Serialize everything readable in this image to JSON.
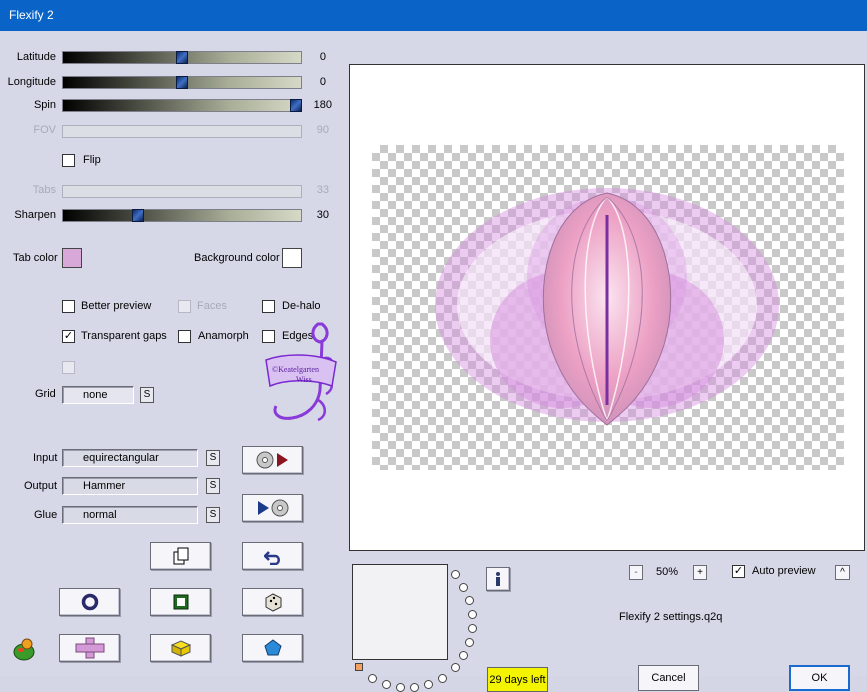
{
  "window": {
    "title": "Flexify 2"
  },
  "sliders": {
    "latitude": {
      "label": "Latitude",
      "value": "0",
      "level": 0.5
    },
    "longitude": {
      "label": "Longitude",
      "value": "0",
      "level": 0.5
    },
    "spin": {
      "label": "Spin",
      "value": "180",
      "level": 1.0
    },
    "fov": {
      "label": "FOV",
      "value": "90",
      "level": 0.5
    },
    "tabs": {
      "label": "Tabs",
      "value": "33",
      "level": 0.33
    },
    "sharpen": {
      "label": "Sharpen",
      "value": "30",
      "level": 0.3
    }
  },
  "flip": {
    "label": "Flip",
    "checked": false
  },
  "colors": {
    "tab_color_label": "Tab color",
    "tab_color": "#d8a8d8",
    "background_color_label": "Background color",
    "background_color": "#ffffff"
  },
  "options": {
    "better_preview": "Better preview",
    "faces": "Faces",
    "de_halo": "De-halo",
    "transparent_gaps": "Transparent gaps",
    "anamorph": "Anamorph",
    "edges": "Edges"
  },
  "grid": {
    "label": "Grid",
    "value": "none",
    "button": "S"
  },
  "io": {
    "input_label": "Input",
    "input_value": "equirectangular",
    "output_label": "Output",
    "output_value": "Hammer",
    "glue_label": "Glue",
    "glue_value": "normal",
    "s_button": "S"
  },
  "watermark": {
    "line1": "©Keatelgarten",
    "line2": "Wiss"
  },
  "zoom": {
    "minus": "-",
    "value": "50%",
    "plus": "+"
  },
  "auto_preview": {
    "label": "Auto preview",
    "checked": true,
    "button": "^"
  },
  "settings_file": "Flexify 2 settings.q2q",
  "trial": "29 days left",
  "buttons": {
    "cancel": "Cancel",
    "ok": "OK"
  },
  "icons": {
    "info": "info-icon",
    "load_preset": "load-preset-icon",
    "save_preset": "save-preset-icon",
    "copy": "copy-icon",
    "undo": "undo-icon",
    "ring": "ring-icon",
    "square": "square-icon",
    "dice": "dice-icon",
    "cross": "cross-icon",
    "cube": "cube-icon",
    "pentagon": "pentagon-icon",
    "app_logo": "app-logo-icon"
  }
}
